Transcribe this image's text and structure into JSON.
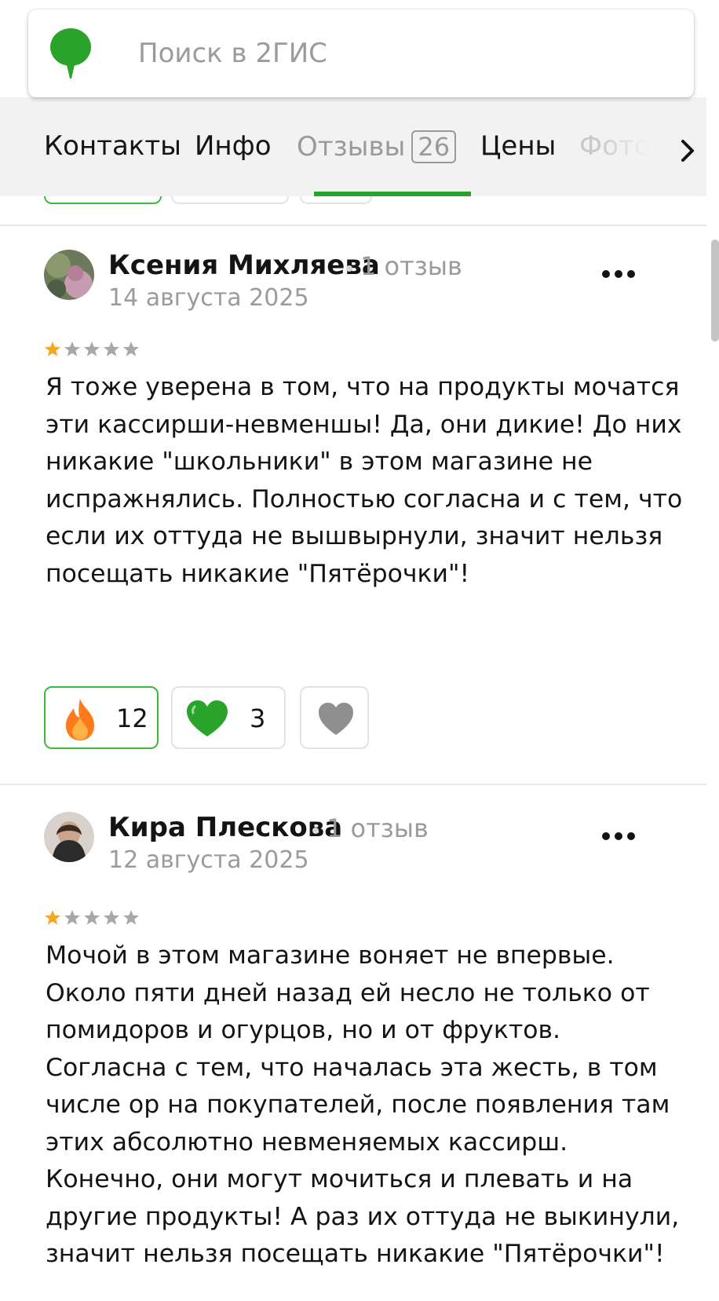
{
  "search": {
    "placeholder": "Поиск в 2ГИС"
  },
  "tabs": [
    {
      "label": "Контакты"
    },
    {
      "label": "Инфо"
    },
    {
      "label": "Отзывы",
      "count": "26",
      "active": true
    },
    {
      "label": "Цены"
    },
    {
      "label": "Фото"
    }
  ],
  "colors": {
    "accent": "#2ca12c",
    "star": "#f5a623",
    "muted": "#9b9b9b"
  },
  "reviews": [
    {
      "author": "Ксения Михляева",
      "author_reviews": "1 отзыв",
      "date": "14 августа 2025",
      "rating": 1,
      "text": "Я тоже уверена в том, что на продукты мочатся эти кассирши-невменшы! Да, они дикие! До них никакие \"школьники\" в этом магазине не испражнялись. Полностью согласна и с тем, что если их оттуда не вышвырнули, значит нельзя посещать никакие \"Пятёрочки\"!",
      "reactions": {
        "fire": "12",
        "green_heart": "3"
      }
    },
    {
      "author": "Кира Плескова",
      "author_reviews": "1 отзыв",
      "date": "12 августа 2025",
      "rating": 1,
      "text": "Мочой в этом магазине воняет не впервые. Около пяти дней назад ей несло не только от помидоров и огурцов, но и от фруктов. Согласна с тем, что началась эта жесть, в том числе ор на покупателей, после появления там этих абсолютно невменяемых кассирш. Конечно, они могут мочиться и плевать и на другие продукты! А раз их оттуда не выкинули, значит нельзя посещать никакие \"Пятёрочки\"!"
    }
  ]
}
